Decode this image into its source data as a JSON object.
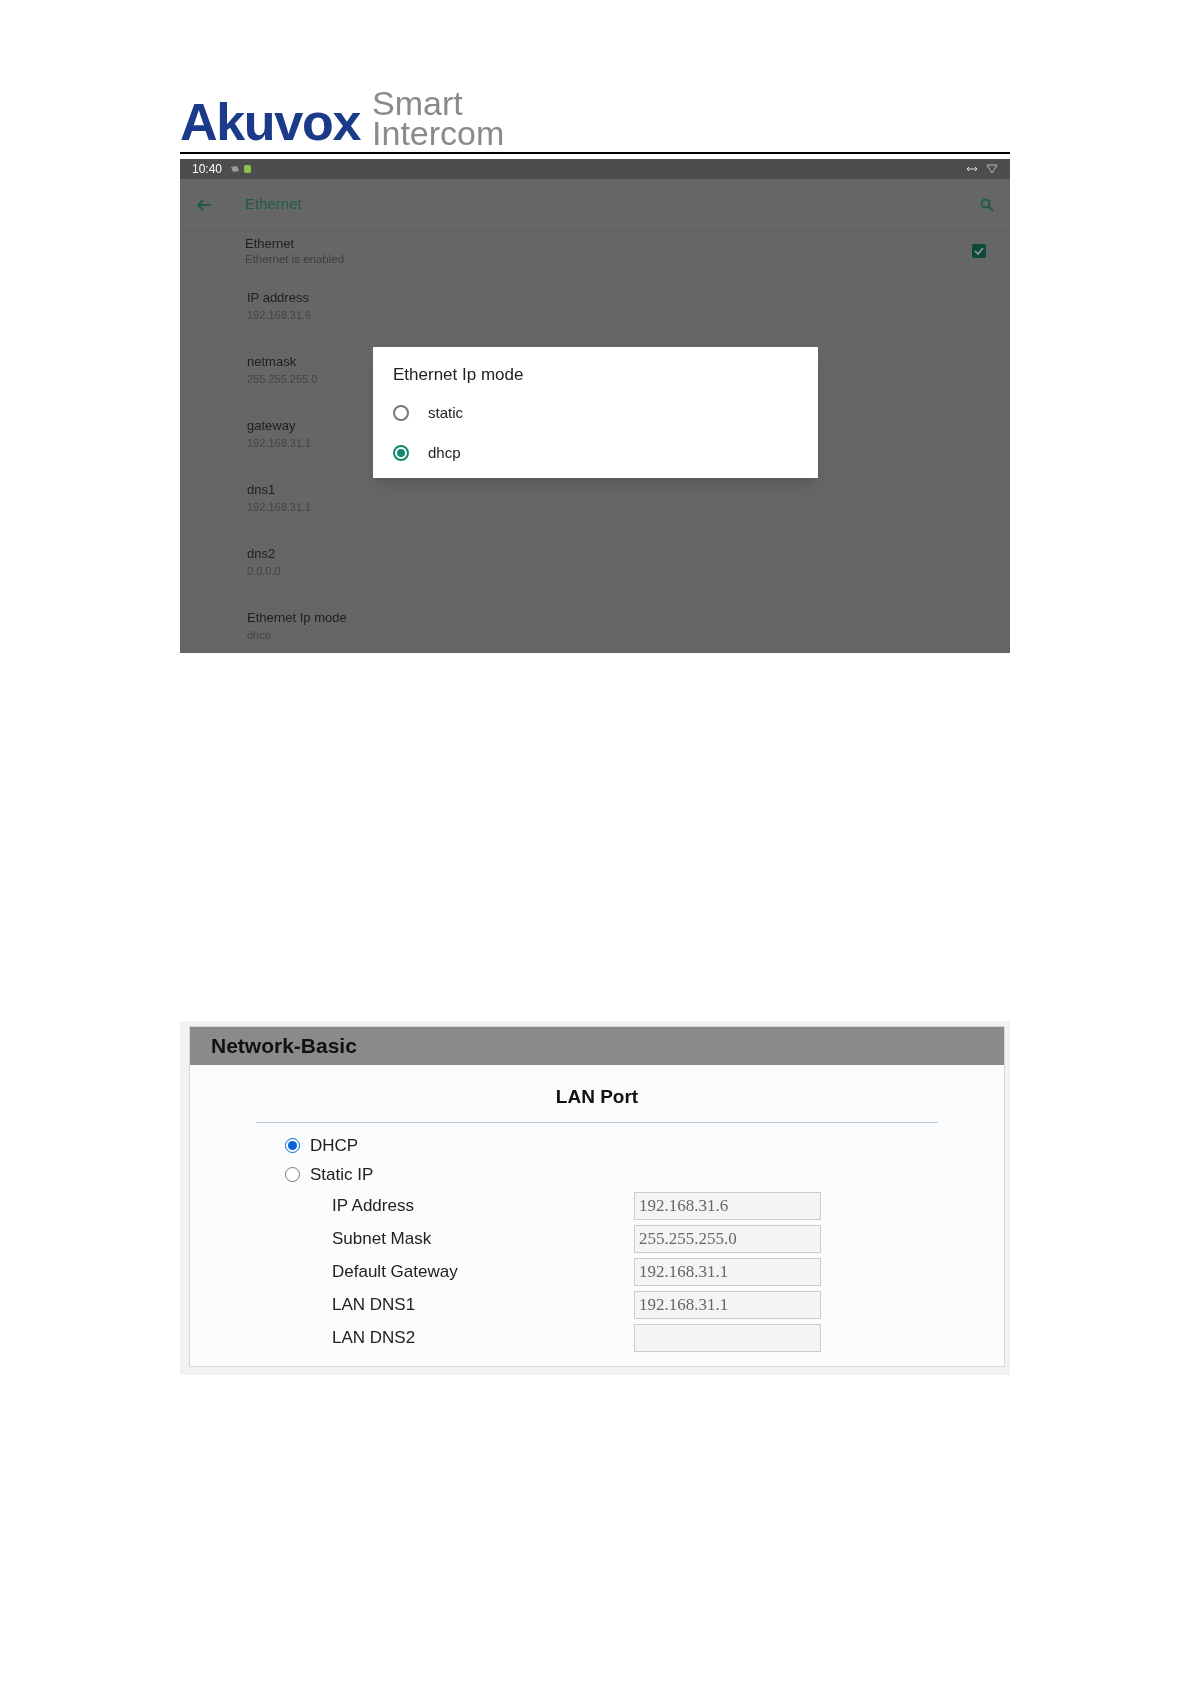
{
  "logo": {
    "brand": "Akuvox",
    "tagline_1": "Smart",
    "tagline_2": "Intercom"
  },
  "device_screen": {
    "status_bar": {
      "time": "10:40"
    },
    "toolbar": {
      "title": "Ethernet"
    },
    "ethernet_toggle": {
      "title": "Ethernet",
      "summary": "Ethernet is enabled",
      "checked": true
    },
    "settings": [
      {
        "title": "IP address",
        "value": "192.168.31.6"
      },
      {
        "title": "netmask",
        "value": "255.255.255.0"
      },
      {
        "title": "gateway",
        "value": "192.168.31.1"
      },
      {
        "title": "dns1",
        "value": "192.168.31.1"
      },
      {
        "title": "dns2",
        "value": "0.0.0.0"
      },
      {
        "title": "Ethernet Ip mode",
        "value": "dhcp"
      }
    ],
    "dialog": {
      "title": "Ethernet Ip mode",
      "options": [
        {
          "label": "static",
          "selected": false
        },
        {
          "label": "dhcp",
          "selected": true
        }
      ]
    }
  },
  "web_panel": {
    "title": "Network-Basic",
    "section": "LAN Port",
    "modes": [
      {
        "label": "DHCP",
        "selected": true
      },
      {
        "label": "Static IP",
        "selected": false
      }
    ],
    "fields": [
      {
        "label": "IP Address",
        "value": "192.168.31.6",
        "disabled": true
      },
      {
        "label": "Subnet Mask",
        "value": "255.255.255.0",
        "disabled": true
      },
      {
        "label": "Default Gateway",
        "value": "192.168.31.1",
        "disabled": true
      },
      {
        "label": "LAN DNS1",
        "value": "192.168.31.1",
        "disabled": true
      },
      {
        "label": "LAN DNS2",
        "disabled": true
      }
    ]
  }
}
